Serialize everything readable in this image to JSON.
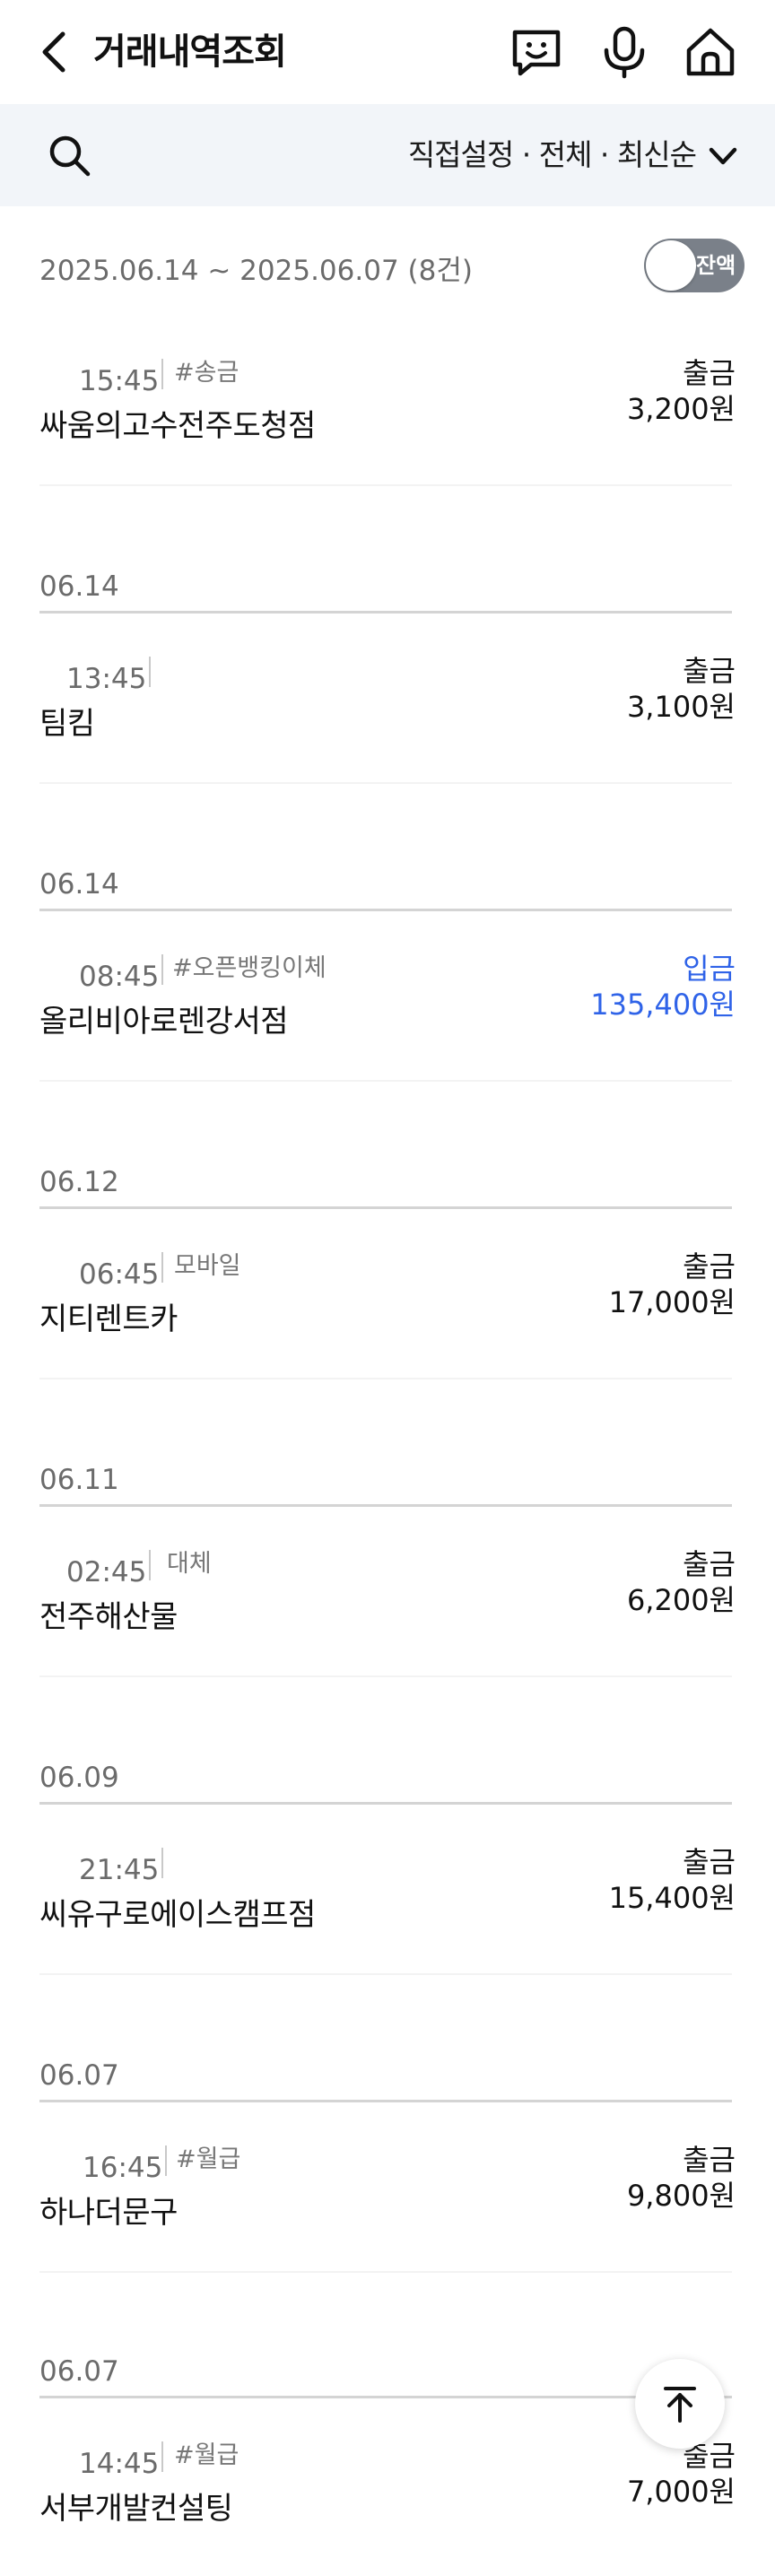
{
  "header": {
    "title": "거래내역조회",
    "icons": [
      "back-arrow-icon",
      "chat-bot-icon",
      "microphone-icon",
      "home-icon"
    ]
  },
  "filter": {
    "label": "직접설정 · 전체 · 최신순",
    "icons": [
      "search-icon",
      "chevron-down-icon"
    ]
  },
  "summary": {
    "range": "2025.06.14 ~ 2025.06.07 (8건)",
    "balance_toggle_label": "잔액",
    "balance_toggle_on": false
  },
  "accent_color": "#2f63e8",
  "transactions": [
    {
      "time": "15:45",
      "tag": "#송금",
      "merchant": "싸움의고수전주도청점",
      "type": "출금",
      "amount": "3,200원"
    },
    {
      "date": "06.14",
      "time": "13:45",
      "tag": "",
      "merchant": "팀킴",
      "type": "출금",
      "amount": "3,100원"
    },
    {
      "date": "06.14",
      "time": "08:45",
      "tag": "#오픈뱅킹이체",
      "merchant": "올리비아로렌강서점",
      "type": "입금",
      "amount": "135,400원"
    },
    {
      "date": "06.12",
      "time": "06:45",
      "tag": "모바일",
      "merchant": "지티렌트카",
      "type": "출금",
      "amount": "17,000원"
    },
    {
      "date": "06.11",
      "time": "02:45",
      "tag": "대체",
      "merchant": "전주해산물",
      "type": "출금",
      "amount": "6,200원"
    },
    {
      "date": "06.09",
      "time": "21:45",
      "tag": "",
      "merchant": "씨유구로에이스캠프점",
      "type": "출금",
      "amount": "15,400원"
    },
    {
      "date": "06.07",
      "time": "16:45",
      "tag": "#월급",
      "merchant": "하나더문구",
      "type": "출금",
      "amount": "9,800원"
    },
    {
      "date": "06.07",
      "time": "14:45",
      "tag": "#월급",
      "merchant": "서부개발컨설팅",
      "type": "출금",
      "amount": "7,000원"
    }
  ],
  "scroll_top_icon": "arrow-up-icon"
}
